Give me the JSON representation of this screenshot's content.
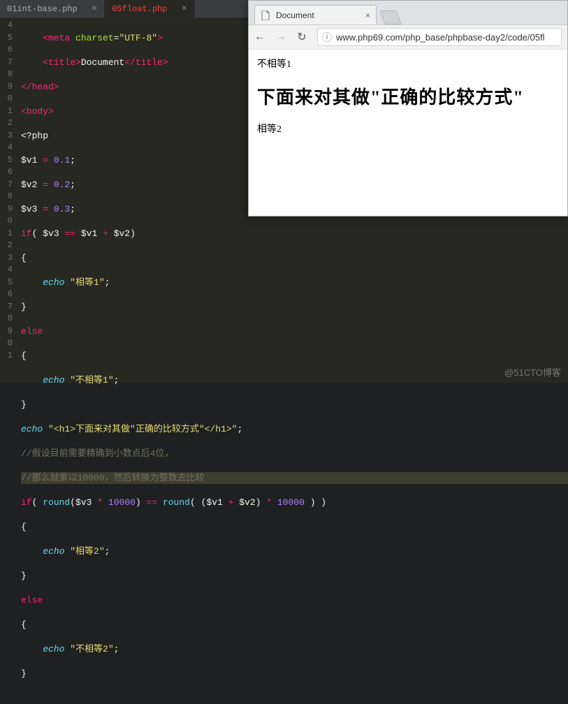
{
  "editor": {
    "tabs": [
      {
        "label": "01int-base.php",
        "active": false
      },
      {
        "label": "05float.php",
        "active": true
      }
    ],
    "gutter_start": 4,
    "gutter_cycle": [
      "4",
      "5",
      "6",
      "7",
      "8",
      "9",
      "0",
      "1",
      "2",
      "3",
      "4",
      "5",
      "6",
      "7",
      "8",
      "9",
      "0",
      "1",
      "2",
      "3",
      "4",
      "5",
      "6",
      "7",
      "8",
      "9",
      "0",
      "1"
    ],
    "code": {
      "meta_open": "<meta ",
      "meta_attr": "charset",
      "meta_eq": "=",
      "meta_val": "\"UTF-8\"",
      "meta_close": ">",
      "title_open": "<title>",
      "title_text": "Document",
      "title_close": "</title>",
      "head_close": "</head>",
      "body_open": "<body>",
      "php_open": "<?php",
      "v1": "$v1",
      "v2": "$v2",
      "v3": "$v3",
      "n01": "0.1",
      "n02": "0.2",
      "n03": "0.3",
      "n10000": "10000",
      "if": "if",
      "else": "else",
      "echo": "echo",
      "round": "round",
      "s_eq1": "\"相等1\"",
      "s_neq1": "\"不相等1\"",
      "s_eq2": "\"相等2\"",
      "s_neq2": "\"不相等2\"",
      "s_h1": "\"<h1>下面来对其做\"正确的比较方式\"</h1>\"",
      "cmt1": "//假设目前需要精确到小数点后4位，",
      "cmt2": "//那么就乘以10000，然后转换为整数去比较"
    }
  },
  "browser": {
    "tab_title": "Document",
    "url": "www.php69.com/php_base/phpbase-day2/code/05fl",
    "content": {
      "line1": "不相等1",
      "h1": "下面来对其做\"正确的比较方式\"",
      "line2": "相等2"
    }
  },
  "watermark": "@51CTO博客"
}
